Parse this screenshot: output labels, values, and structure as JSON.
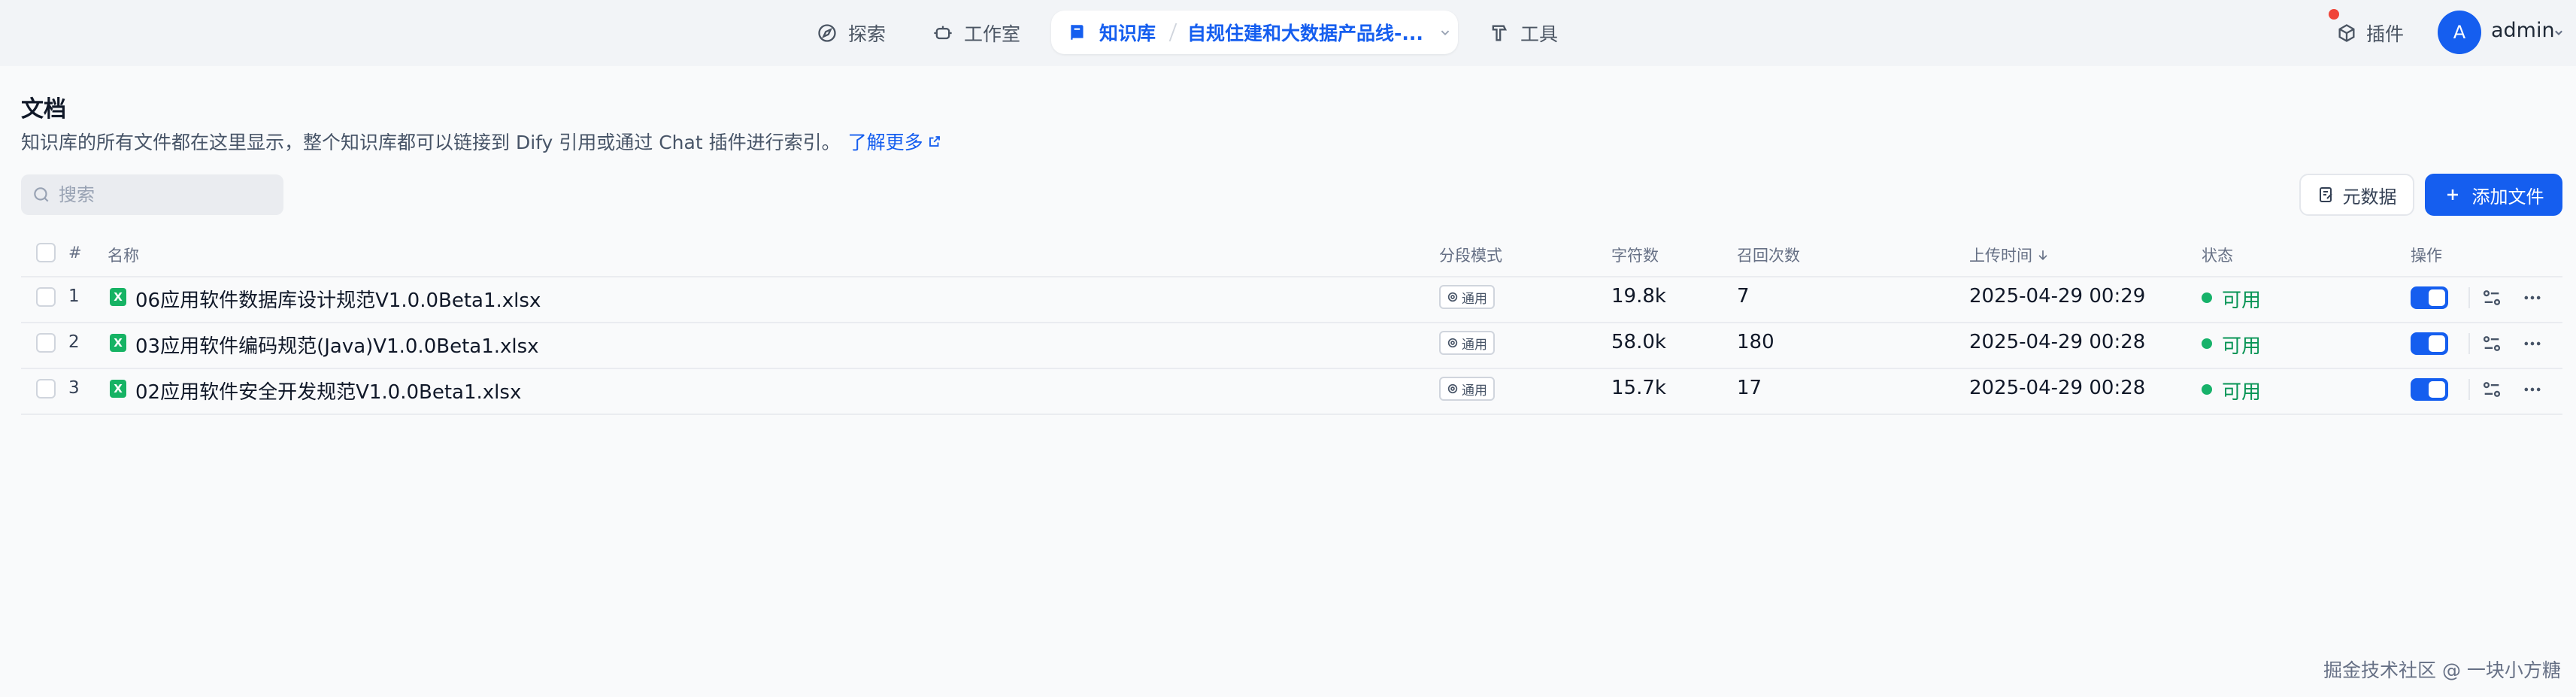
{
  "nav": {
    "explore": "探索",
    "studio": "工作室",
    "knowledge": "知识库",
    "dataset_name": "自规住建和大数据产品线-...",
    "tools": "工具",
    "plugins": "插件"
  },
  "user": {
    "avatar_initial": "A",
    "name": "admin"
  },
  "page": {
    "title": "文档",
    "description": "知识库的所有文件都在这里显示，整个知识库都可以链接到 Dify 引用或通过 Chat 插件进行索引。",
    "learn_more": "了解更多"
  },
  "search": {
    "placeholder": "搜索",
    "value": ""
  },
  "buttons": {
    "metadata": "元数据",
    "add_file": "添加文件"
  },
  "table": {
    "headers": {
      "index": "#",
      "name": "名称",
      "mode": "分段模式",
      "chars": "字符数",
      "hits": "召回次数",
      "upload_time": "上传时间",
      "status": "状态",
      "actions": "操作"
    },
    "rows": [
      {
        "index": "1",
        "name": "06应用软件数据库设计规范V1.0.0Beta1.xlsx",
        "mode": "通用",
        "chars": "19.8k",
        "hits": "7",
        "upload_time": "2025-04-29 00:29",
        "status": "可用",
        "enabled": true
      },
      {
        "index": "2",
        "name": "03应用软件编码规范(Java)V1.0.0Beta1.xlsx",
        "mode": "通用",
        "chars": "58.0k",
        "hits": "180",
        "upload_time": "2025-04-29 00:28",
        "status": "可用",
        "enabled": true
      },
      {
        "index": "3",
        "name": "02应用软件安全开发规范V1.0.0Beta1.xlsx",
        "mode": "通用",
        "chars": "15.7k",
        "hits": "17",
        "upload_time": "2025-04-29 00:28",
        "status": "可用",
        "enabled": true
      }
    ]
  },
  "file_icon_letter": "X",
  "watermark": "掘金技术社区 @ 一块小方糖",
  "colors": {
    "accent": "#155eef",
    "success": "#17b26a",
    "excel": "#16b364"
  }
}
